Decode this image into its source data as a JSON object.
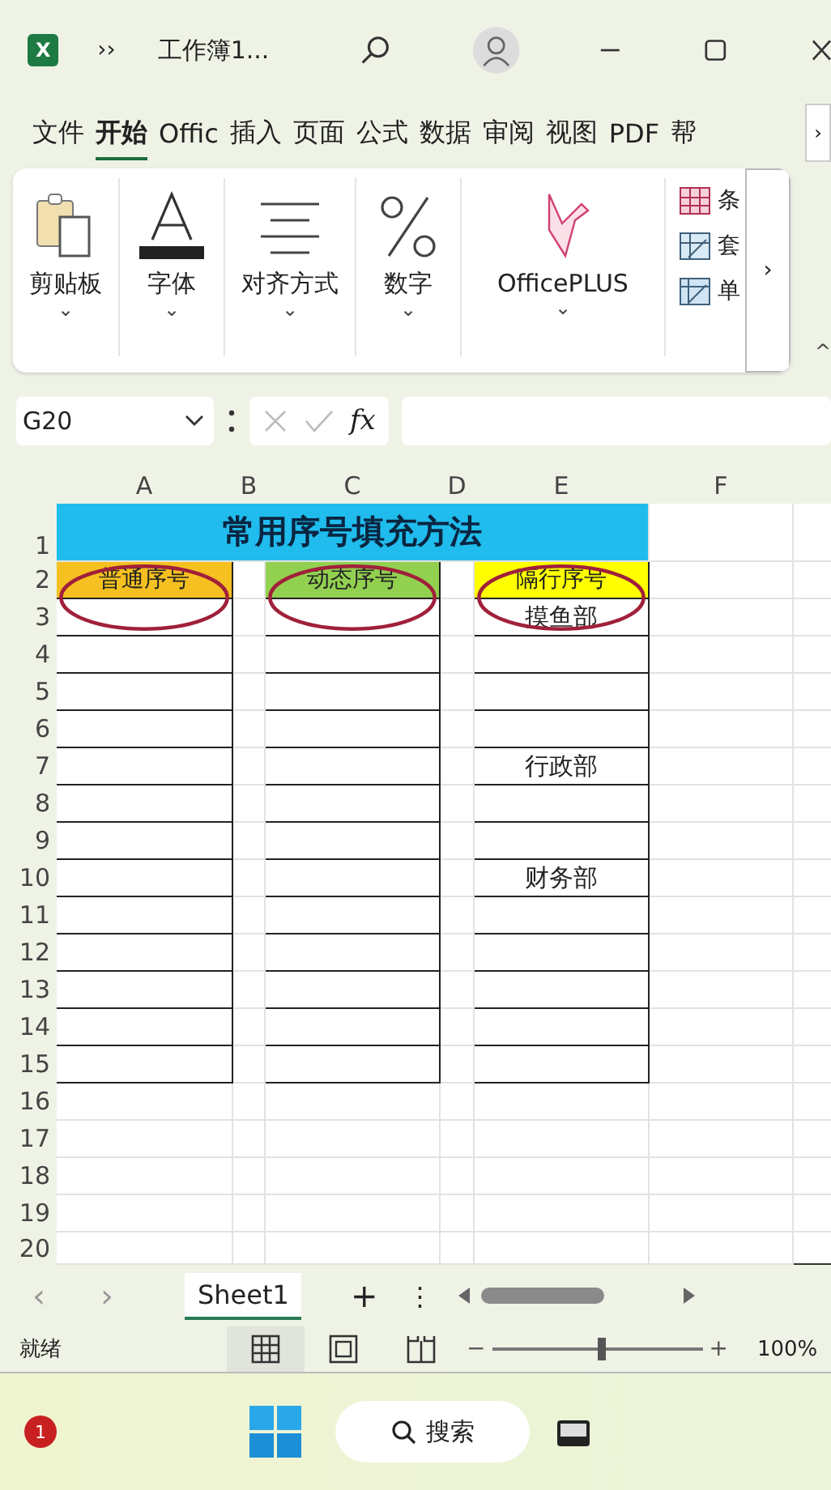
{
  "title_bar": {
    "app_badge": "X",
    "overflow": "››",
    "title": "工作簿1..."
  },
  "ribbon_tabs": [
    {
      "label": "文件",
      "selected": false
    },
    {
      "label": "开始",
      "selected": true
    },
    {
      "label": "Offic",
      "selected": false
    },
    {
      "label": "插入",
      "selected": false
    },
    {
      "label": "页面",
      "selected": false
    },
    {
      "label": "公式",
      "selected": false
    },
    {
      "label": "数据",
      "selected": false
    },
    {
      "label": "审阅",
      "selected": false
    },
    {
      "label": "视图",
      "selected": false
    },
    {
      "label": "PDF",
      "selected": false
    },
    {
      "label": "帮",
      "selected": false
    }
  ],
  "ribbon_tabs_more": "›",
  "ribbon_groups": [
    {
      "kind": "clipboard",
      "label": "剪贴板",
      "caret": "⌄"
    },
    {
      "kind": "font",
      "label": "字体",
      "caret": "⌄"
    },
    {
      "kind": "align",
      "label": "对齐方式",
      "caret": "⌄"
    },
    {
      "kind": "number",
      "label": "数字",
      "caret": "⌄"
    },
    {
      "kind": "officeplus",
      "label": "OfficePLUS",
      "caret": "⌄"
    }
  ],
  "ribbon_styles": [
    {
      "kind": "grid",
      "label": "条"
    },
    {
      "kind": "table",
      "label": "套"
    },
    {
      "kind": "cell",
      "label": "单"
    }
  ],
  "ribbon_more": "›",
  "ribbon_collapse": "^",
  "formula_bar": {
    "name_box": "G20",
    "fx": "fx"
  },
  "columns": [
    "A",
    "B",
    "C",
    "D",
    "E",
    "F"
  ],
  "sheet": {
    "title": "常用序号填充方法",
    "headers": [
      {
        "text": "普通序号",
        "color": "#f5c020"
      },
      {
        "text": "动态序号",
        "color": "#92d050"
      },
      {
        "text": "隔行序号",
        "color": "#ffff00"
      }
    ],
    "rows": [
      {
        "number": "1"
      },
      {
        "number": "2"
      },
      {
        "number": "3",
        "bordered": true,
        "e": "摸鱼部"
      },
      {
        "number": "4",
        "bordered": true
      },
      {
        "number": "5",
        "bordered": true
      },
      {
        "number": "6",
        "bordered": true
      },
      {
        "number": "7",
        "bordered": true,
        "e": "行政部"
      },
      {
        "number": "8",
        "bordered": true
      },
      {
        "number": "9",
        "bordered": true
      },
      {
        "number": "10",
        "bordered": true,
        "e": "财务部"
      },
      {
        "number": "11",
        "bordered": true
      },
      {
        "number": "12",
        "bordered": true
      },
      {
        "number": "13",
        "bordered": true
      },
      {
        "number": "14",
        "bordered": true
      },
      {
        "number": "15",
        "bordered": true
      },
      {
        "number": "16",
        "bordered": false
      },
      {
        "number": "17",
        "bordered": false
      },
      {
        "number": "18",
        "bordered": false
      },
      {
        "number": "19",
        "bordered": false
      },
      {
        "number": "20",
        "bordered": false
      }
    ]
  },
  "sheet_tabs": [
    {
      "label": "Sheet1",
      "selected": true
    }
  ],
  "sheet_nav": {
    "prev": "‹",
    "next": "›",
    "add": "+",
    "more": "⋮"
  },
  "status_bar": {
    "text": "就绪",
    "views": [
      {
        "kind": "normal",
        "selected": true
      },
      {
        "kind": "layout",
        "selected": false
      },
      {
        "kind": "pagebreak",
        "selected": false
      }
    ],
    "zoom_out": "−",
    "zoom_in": "+",
    "zoom": {
      "level": 0.52
    },
    "zoom_text": "100%"
  },
  "taskbar": {
    "badge": "1",
    "search": "搜索"
  }
}
